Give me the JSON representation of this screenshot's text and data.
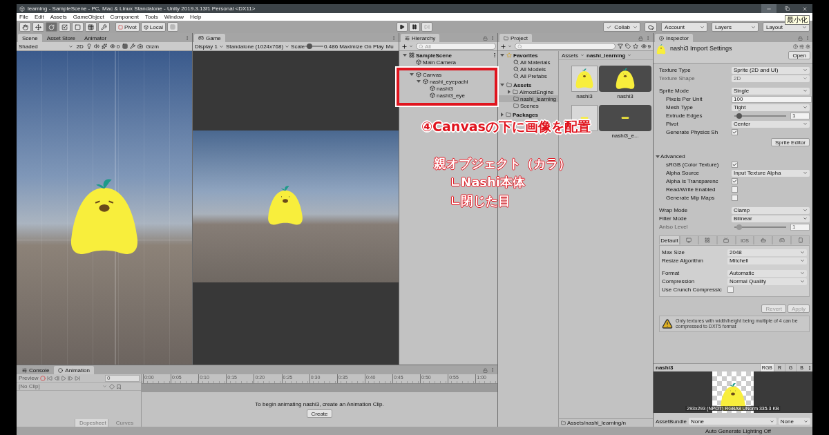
{
  "window": {
    "title": "learning - SampleScene - PC, Mac & Linux Standalone - Unity 2019.3.13f1 Personal <DX11>",
    "tooltip": "最小化"
  },
  "menu": [
    "File",
    "Edit",
    "Assets",
    "GameObject",
    "Component",
    "Tools",
    "Window",
    "Help"
  ],
  "toolbar": {
    "tools": [
      {
        "selected": false
      },
      {
        "selected": false
      },
      {
        "selected": true
      },
      {
        "selected": false
      },
      {
        "selected": false
      },
      {
        "selected": false
      },
      {
        "selected": false
      }
    ],
    "pivot": "Pivot",
    "local": "Local",
    "collab": "Collab",
    "account": "Account",
    "layers": "Layers",
    "layout": "Layout"
  },
  "scene": {
    "tabs": [
      {
        "label": "Scene",
        "selected": true
      },
      {
        "label": "Asset Store",
        "selected": false
      },
      {
        "label": "Animator",
        "selected": false
      }
    ],
    "shading": "Shaded",
    "mode_2d": "2D",
    "hidden_count": "0",
    "gizmos": "Gizm"
  },
  "game": {
    "tab": "Game",
    "display": "Display 1",
    "resolution": "Standalone (1024x768)",
    "scale_label": "Scale",
    "scale": {
      "level": 0.1
    },
    "scale_value": "0.486",
    "maximize": "Maximize On Play",
    "mute": "Mu"
  },
  "hierarchy": {
    "tab": "Hierarchy",
    "search_placeholder": "All",
    "items": [
      {
        "label": "SampleScene",
        "expanded": true,
        "children": [
          {
            "label": "Main Camera"
          },
          {
            "label": "Canvas",
            "expanded": true,
            "children": [
              {
                "label": "nashi_eyepachi",
                "expanded": true,
                "children": [
                  {
                    "label": "nashi3"
                  },
                  {
                    "label": "nashi3_eye"
                  }
                ]
              }
            ]
          }
        ]
      }
    ]
  },
  "project": {
    "tab": "Project",
    "hidden_count": "9",
    "tree": [
      {
        "label": "Favorites",
        "kind": "favorites",
        "selected": false,
        "expanded": true,
        "children": [
          {
            "label": "All Materials",
            "kind": "search",
            "selected": false
          },
          {
            "label": "All Models",
            "kind": "search",
            "selected": false
          },
          {
            "label": "All Prefabs",
            "kind": "search",
            "selected": false
          }
        ]
      },
      {
        "label": "Assets",
        "kind": "folder",
        "selected": false,
        "expanded": true,
        "children": [
          {
            "label": "AlmostEngine",
            "kind": "folder",
            "selected": false,
            "expanded": false
          },
          {
            "label": "nashi_learning",
            "kind": "folder",
            "selected": true
          },
          {
            "label": "Scenes",
            "kind": "folder",
            "selected": false
          }
        ]
      },
      {
        "label": "Packages",
        "kind": "folder",
        "selected": false,
        "expanded": false
      }
    ],
    "breadcrumb": [
      "Assets",
      "nashi_learning"
    ],
    "assets": [
      {
        "kind": "texture",
        "label": "nashi3"
      },
      {
        "kind": "sprite",
        "label": "nashi3"
      },
      {
        "kind": "eyetexture"
      },
      {
        "kind": "eyesprite",
        "label": "nashi3_e..."
      }
    ],
    "path": "Assets/nashi_learning/n"
  },
  "inspector": {
    "tab": "Inspector",
    "title": "nashi3 Import Settings",
    "open": "Open",
    "rows": [
      {
        "kind": "dropdown",
        "label": "Texture Type",
        "value": "Sprite (2D and UI)",
        "disabled": false
      },
      {
        "kind": "dropdown",
        "label": "Texture Shape",
        "value": "2D",
        "disabled": true
      },
      {
        "kind": "dropdown",
        "label": "Sprite Mode",
        "value": "Single",
        "disabled": false,
        "children": [
          {
            "kind": "field",
            "label": "Pixels Per Unit",
            "value": "100"
          },
          {
            "kind": "dropdown",
            "label": "Mesh Type",
            "value": "Tight",
            "disabled": false
          },
          {
            "kind": "slider",
            "label": "Extrude Edges",
            "level": 0.05,
            "value": "1",
            "disabled": false
          },
          {
            "kind": "dropdown",
            "label": "Pivot",
            "value": "Center",
            "disabled": false
          },
          {
            "kind": "checkbox",
            "label": "Generate Physics Sh",
            "checked": true
          }
        ]
      },
      {
        "kind": "button",
        "label": "Sprite Editor"
      },
      {
        "kind": "section",
        "label": "Advanced",
        "expanded": true,
        "children": [
          {
            "kind": "checkbox",
            "label": "sRGB (Color Texture)",
            "checked": true
          },
          {
            "kind": "dropdown",
            "label": "Alpha Source",
            "value": "Input Texture Alpha",
            "disabled": false
          },
          {
            "kind": "checkbox",
            "label": "Alpha Is Transparenc",
            "checked": true
          },
          {
            "kind": "checkbox",
            "label": "Read/Write Enabled",
            "checked": false
          },
          {
            "kind": "checkbox",
            "label": "Generate Mip Maps",
            "checked": false
          }
        ]
      },
      {
        "kind": "dropdown",
        "label": "Wrap Mode",
        "value": "Clamp",
        "disabled": false
      },
      {
        "kind": "dropdown",
        "label": "Filter Mode",
        "value": "Bilinear",
        "disabled": false
      },
      {
        "kind": "slider",
        "label": "Aniso Level",
        "level": 0.05,
        "value": "1",
        "disabled": true
      }
    ],
    "platforms": [
      {
        "kind": "default",
        "label": "Default",
        "selected": true
      },
      {
        "kind": "monitor",
        "selected": false
      },
      {
        "kind": "windows",
        "selected": false
      },
      {
        "kind": "tv",
        "selected": false
      },
      {
        "kind": "ios",
        "label": "iOS",
        "selected": false
      },
      {
        "kind": "android",
        "selected": false
      },
      {
        "kind": "robot",
        "selected": false
      },
      {
        "kind": "phone",
        "selected": false
      }
    ],
    "platform_rows": [
      {
        "kind": "dropdown",
        "label": "Max Size",
        "value": "2048",
        "disabled": false
      },
      {
        "kind": "dropdown",
        "label": "Resize Algorithm",
        "value": "Mitchell",
        "disabled": false
      },
      {
        "kind": "dropdown",
        "label": "Format",
        "value": "Automatic",
        "disabled": false
      },
      {
        "kind": "dropdown",
        "label": "Compression",
        "value": "Normal Quality",
        "disabled": false
      },
      {
        "kind": "checkbox",
        "label": "Use Crunch Compressic",
        "checked": false
      }
    ],
    "revert": "Revert",
    "apply": "Apply",
    "warning": "Only textures with width/height being multiple of 4 can be compressed to DXT5 format",
    "preview": {
      "name": "nashi3",
      "channels": [
        {
          "label": "RGB",
          "selected": true
        },
        {
          "label": "R",
          "selected": false
        },
        {
          "label": "G",
          "selected": false
        },
        {
          "label": "B",
          "selected": false
        }
      ],
      "info": "293x293 (NPOT)  RGBA8 UNorm   335.3 KB"
    },
    "asset_bundle": {
      "label": "AssetBundle",
      "name": "None",
      "variant": "None"
    }
  },
  "animation": {
    "tabs": [
      {
        "label": "Console",
        "selected": false
      },
      {
        "label": "Animation",
        "selected": true
      }
    ],
    "preview": "Preview",
    "frame": "0",
    "clip": "[No Clip]",
    "ticks": [
      "0:00",
      "0:05",
      "0:10",
      "0:15",
      "0:20",
      "0:25",
      "0:30",
      "0:35",
      "0:40",
      "0:45",
      "0:50",
      "0:55",
      "1:00"
    ],
    "message": "To begin animating nashi3, create an Animation Clip.",
    "create": "Create",
    "views": [
      {
        "label": "Dopesheet",
        "selected": true
      },
      {
        "label": "Curves",
        "selected": false
      }
    ]
  },
  "status": "Auto Generate Lighting Off",
  "annotations": {
    "step": "④Canvasの下に画像を配置",
    "note": {
      "text": "親オブジェクト（カラ）",
      "children": [
        {
          "text": "∟Nashi本体"
        },
        {
          "text": "∟閉じた目"
        }
      ]
    }
  }
}
